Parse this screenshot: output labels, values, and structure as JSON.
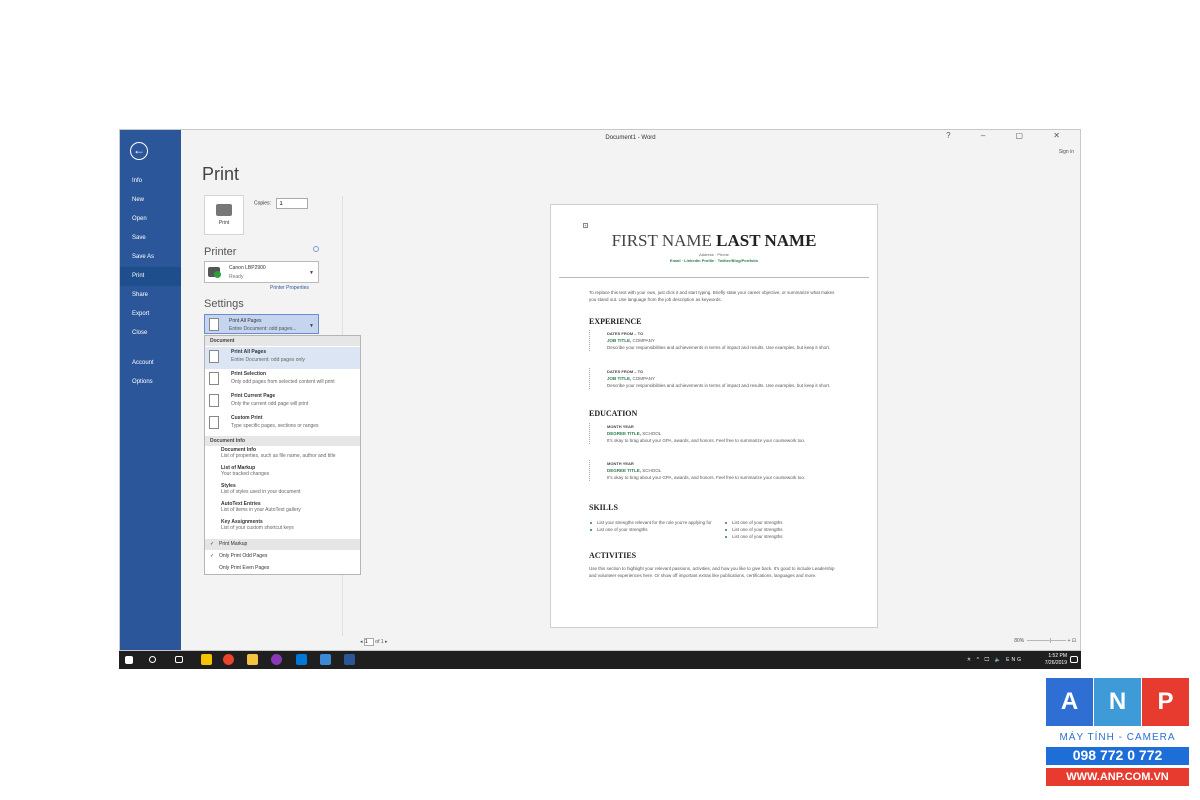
{
  "window": {
    "title": "Document1 - Word",
    "sign_in": "Sign in",
    "controls": "? – ▢ ✕"
  },
  "sidebar": {
    "items": [
      {
        "label": "Info"
      },
      {
        "label": "New"
      },
      {
        "label": "Open"
      },
      {
        "label": "Save"
      },
      {
        "label": "Save As"
      },
      {
        "label": "Print"
      },
      {
        "label": "Share"
      },
      {
        "label": "Export"
      },
      {
        "label": "Close"
      },
      {
        "label": "Account"
      },
      {
        "label": "Options"
      }
    ],
    "active": "Print"
  },
  "print_panel": {
    "title": "Print",
    "print_button": "Print",
    "copies_label": "Copies:",
    "copies_value": "1",
    "printer_heading": "Printer",
    "printer_name": "Canon LBP2900",
    "printer_status": "Ready",
    "printer_properties": "Printer Properties",
    "settings_heading": "Settings",
    "setting_title": "Print All Pages",
    "setting_sub": "Entire Document: odd pages..."
  },
  "dropdown": {
    "section_document": "Document",
    "options": [
      {
        "title": "Print All Pages",
        "sub": "Entire Document: odd pages only"
      },
      {
        "title": "Print Selection",
        "sub": "Only odd pages from selected content will print"
      },
      {
        "title": "Print Current Page",
        "sub": "Only the current odd page will print"
      },
      {
        "title": "Custom Print",
        "sub": "Type specific pages, sections or ranges"
      }
    ],
    "section_info": "Document Info",
    "info_items": [
      {
        "title": "Document Info",
        "sub": "List of properties, such as file name, author and title"
      },
      {
        "title": "List of Markup",
        "sub": "Your tracked changes"
      },
      {
        "title": "Styles",
        "sub": "List of styles used in your document"
      },
      {
        "title": "AutoText Entries",
        "sub": "List of items in your AutoText gallery"
      },
      {
        "title": "Key Assignments",
        "sub": "List of your custom shortcut keys"
      }
    ],
    "checks": [
      {
        "label": "Print Markup",
        "mark": "✓"
      },
      {
        "label": "Only Print Odd Pages",
        "mark": "✓"
      },
      {
        "label": "Only Print Even Pages",
        "mark": ""
      }
    ]
  },
  "footer": {
    "page_value": "1",
    "page_of": "of 1",
    "zoom": "80%"
  },
  "resume": {
    "first": "FIRST NAME",
    "last": "LAST NAME",
    "address": "Address · Phone",
    "links": "Email · LinkedIn Profile · Twitter/Blog/Portfolio",
    "intro": "To replace this text with your own, just click it and start typing. Briefly state your career objective, or summarize what makes you stand out. Use language from the job description as keywords.",
    "experience_h": "EXPERIENCE",
    "jobs": [
      {
        "dates": "DATES FROM – TO",
        "title": "JOB TITLE,",
        "company": " COMPANY",
        "desc": "Describe your responsibilities and achievements in terms of impact and results. Use examples, but keep it short."
      },
      {
        "dates": "DATES FROM – TO",
        "title": "JOB TITLE,",
        "company": " COMPANY",
        "desc": "Describe your responsibilities and achievements in terms of impact and results. Use examples, but keep it short."
      }
    ],
    "education_h": "EDUCATION",
    "edu": [
      {
        "dates": "MONTH YEAR",
        "title": "DEGREE TITLE,",
        "company": " SCHOOL",
        "desc": "It's okay to brag about your GPA, awards, and honors. Feel free to summarize your coursework too."
      },
      {
        "dates": "MONTH YEAR",
        "title": "DEGREE TITLE,",
        "company": " SCHOOL",
        "desc": "It's okay to brag about your GPA, awards, and honors. Feel free to summarize your coursework too."
      }
    ],
    "skills_h": "SKILLS",
    "skills_left": [
      "List your strengths relevant for the role you're applying for",
      "List one of your strengths"
    ],
    "skills_right": [
      "List one of your strengths",
      "List one of your strengths",
      "List one of your strengths"
    ],
    "activities_h": "ACTIVITIES",
    "activities": "Use this section to highlight your relevant passions, activities, and how you like to give back. It's good to include Leadership and volunteer experiences here. Or show off important extras like publications, certifications, languages and more."
  },
  "taskbar": {
    "tray": "ㅊ ^ 🖵 🔈 ENG",
    "time": "1:52 PM",
    "date": "7/26/2019"
  },
  "watermark": {
    "letters": [
      "A",
      "N",
      "P"
    ],
    "colors": [
      "#2f6fd4",
      "#3f9ad8",
      "#e63b2e"
    ],
    "tagline": "MÁY TÍNH - CAMERA",
    "phone": "098 772 0 772",
    "website": "WWW.ANP.COM.VN"
  }
}
